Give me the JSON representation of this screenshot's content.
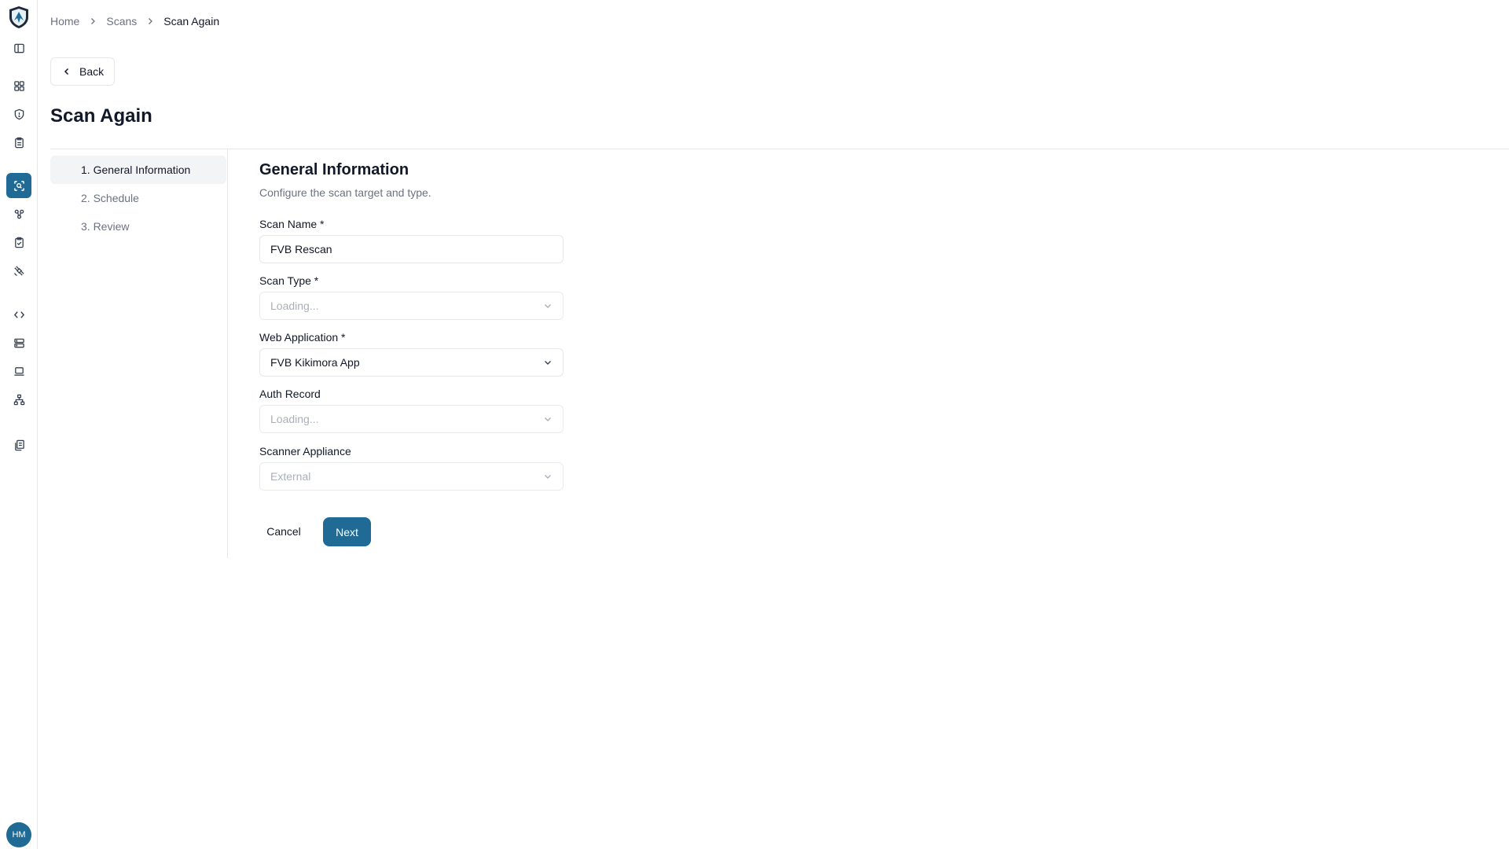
{
  "breadcrumb": {
    "home": "Home",
    "scans": "Scans",
    "current": "Scan Again"
  },
  "back_label": "Back",
  "page_title": "Scan Again",
  "steps": [
    {
      "label": "1. General Information",
      "active": true
    },
    {
      "label": "2. Schedule",
      "active": false
    },
    {
      "label": "3. Review",
      "active": false
    }
  ],
  "section": {
    "title": "General Information",
    "description": "Configure the scan target and type."
  },
  "form": {
    "scan_name": {
      "label": "Scan Name *",
      "value": "FVB Rescan"
    },
    "scan_type": {
      "label": "Scan Type *",
      "value": "Loading..."
    },
    "web_application": {
      "label": "Web Application *",
      "value": "FVB Kikimora App"
    },
    "auth_record": {
      "label": "Auth Record",
      "value": "Loading..."
    },
    "scanner_appliance": {
      "label": "Scanner Appliance",
      "value": "External"
    }
  },
  "actions": {
    "cancel": "Cancel",
    "next": "Next"
  },
  "user": {
    "initials": "HM"
  },
  "colors": {
    "accent": "#1f6b95",
    "border": "#e5e7eb",
    "muted_text": "#6b7280"
  },
  "sidebar_icons": [
    "panel-toggle-icon",
    "dashboard-icon",
    "shield-icon",
    "clipboard-icon",
    "scan-icon",
    "integrations-icon",
    "checklist-icon",
    "satellite-icon",
    "code-icon",
    "server-icon",
    "laptop-icon",
    "network-icon",
    "reports-icon"
  ]
}
